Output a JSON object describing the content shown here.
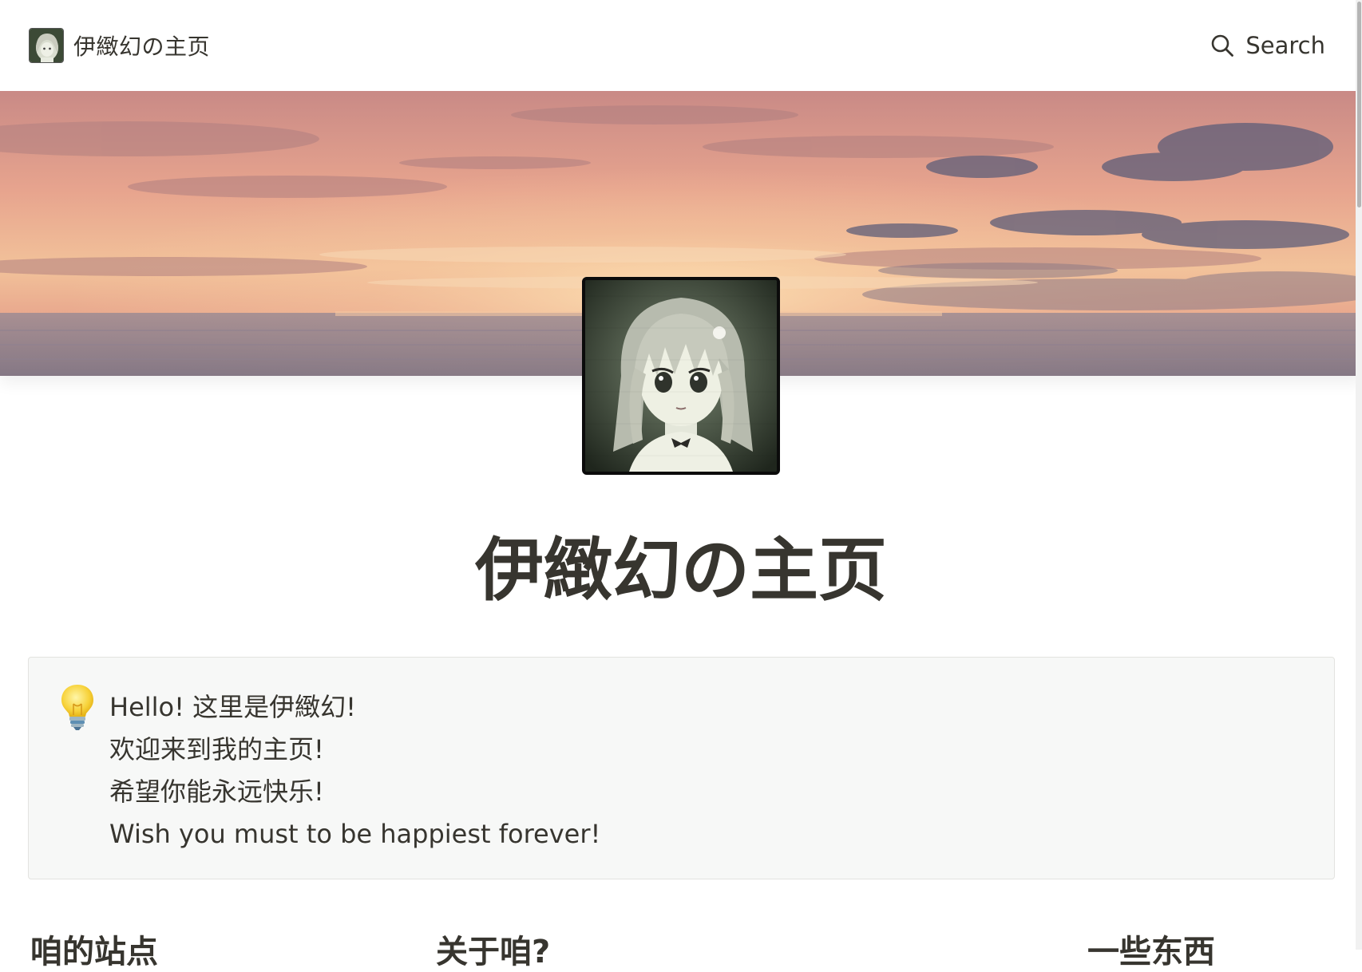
{
  "topbar": {
    "site_title": "伊緻幻の主页",
    "search_label": "Search"
  },
  "page": {
    "title": "伊緻幻の主页"
  },
  "callout": {
    "icon": "lightbulb-icon",
    "lines": [
      "Hello! 这里是伊緻幻!",
      "欢迎来到我的主页!",
      "希望你能永远快乐!",
      "Wish you must to be happiest forever!"
    ]
  },
  "columns": {
    "left_heading": "咱的站点",
    "middle_heading": "关于咱?",
    "right_heading": "一些东西"
  }
}
